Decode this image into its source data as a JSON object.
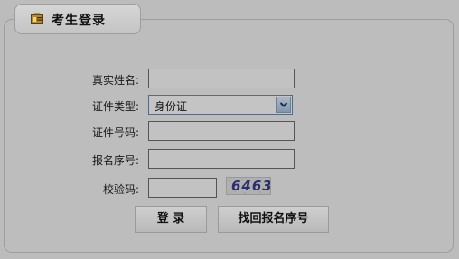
{
  "tab": {
    "title": "考生登录",
    "icon": "id-card-icon"
  },
  "form": {
    "real_name_label": "真实姓名:",
    "id_type_label": "证件类型:",
    "id_type_value": "身份证",
    "id_number_label": "证件号码:",
    "reg_number_label": "报名序号:",
    "captcha_label": "校验码:",
    "captcha_code": "6463",
    "real_name_value": "",
    "id_number_value": "",
    "reg_number_value": "",
    "captcha_value": ""
  },
  "buttons": {
    "login": "登 录",
    "recover": "找回报名序号"
  }
}
